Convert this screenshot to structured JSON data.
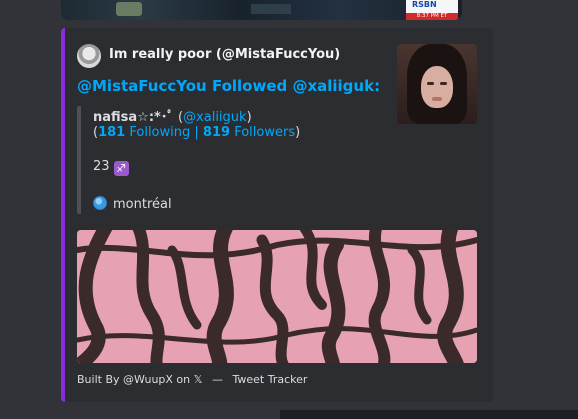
{
  "top_media": {
    "badge_brand": "RSBN",
    "badge_time": "8:37 PM ET"
  },
  "embed": {
    "accent_color": "#8a2be2",
    "author": "Im really poor (@MistaFuccYou)",
    "title": "@MistaFuccYou Followed @xaliiguk:",
    "profile": {
      "name": "nafisa☆:*･ﾟ",
      "handle": "@xaliiguk",
      "following_count": "181",
      "following_label": "Following",
      "followers_count": "819",
      "followers_label": "Followers",
      "bio": "23",
      "bio_sign": "♐",
      "location": "montréal"
    },
    "footer": {
      "built_by": "Built By @WuupX on 𝕏",
      "separator": "—",
      "app_name": "Tweet Tracker"
    }
  }
}
